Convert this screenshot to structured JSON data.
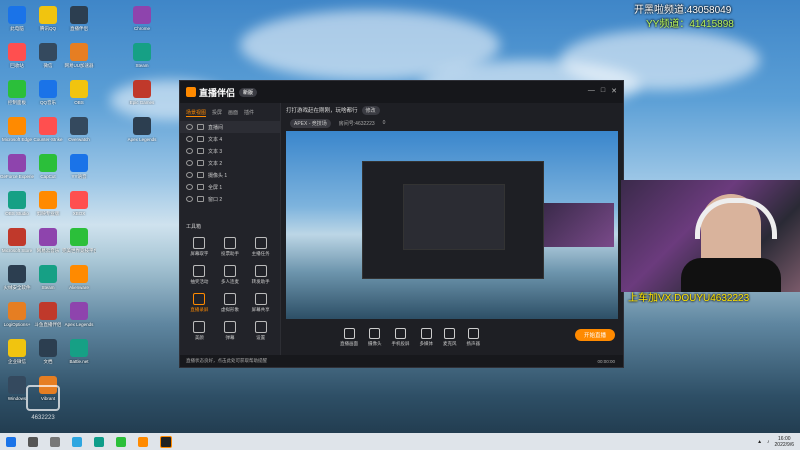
{
  "overlay": {
    "line1": "开黑啦频道:43058049",
    "line2": "YY频道：41415898",
    "webcam_caption": "上车加VX:DOUYU4632223",
    "watermark_room": "4632223"
  },
  "desktop_icons_col1": [
    "此电脑",
    "回收站",
    "控制面板",
    "Microsoft Edge",
    "GeForce Experience",
    "OBS Studio",
    "Microsoft Store",
    "火绒安全软件",
    "LogiOptions+",
    "企业微信",
    "Windows"
  ],
  "desktop_icons_col2": [
    "腾讯QQ",
    "微信",
    "QQ音乐",
    "Counter-Strike",
    "CapCut",
    "剪映专业版",
    "网易云音乐",
    "Steam",
    "斗鱼直播伴侣",
    "文档",
    "Vibrant"
  ],
  "desktop_icons_col3": [
    "直播伴侣",
    "网易UU加速器",
    "OBS",
    "Overwatch",
    "YY语音",
    "XBOX",
    "完美世界竞技平台",
    "Alienware",
    "Apex Legends",
    "Battle.net"
  ],
  "desktop_icons_col4": [
    "Chrome",
    "Steam",
    "Epic Games",
    "Apex Legends"
  ],
  "app": {
    "brand": "直播伴侣",
    "brand_badge": "新版",
    "tabs": [
      "场景视图",
      "投屏",
      "画面",
      "插件"
    ],
    "sources": [
      "直播间",
      "文本 4",
      "文本 3",
      "文本 2",
      "摄像头 1",
      "全屏 1",
      "窗口 2"
    ],
    "tools_title": "工具箱",
    "tools": [
      "屏幕取字",
      "投票助手",
      "主播任务",
      "抽奖活动",
      "多人连麦",
      "转发助手",
      "直播录屏",
      "虚拟形象",
      "屏幕共享",
      "美颜",
      "弹幕",
      "设置"
    ],
    "topbar_text": "打打游戏赶在刚刚，玩啥都行",
    "topbar_tag": "修改",
    "game_tag": "APEX - 竞技场",
    "room_label": "房间号:4632223",
    "fans": "0",
    "bottom_tools": [
      "直播画面",
      "摄像头",
      "手机投屏",
      "多媒体",
      "麦克风",
      "扬声器"
    ],
    "start_live": "开始直播",
    "status_text": "直播状态良好，点击此处可获取帮助提醒",
    "status_right": "00:00:00"
  },
  "taskbar": {
    "time": "16:00",
    "date": "2022/9/6"
  }
}
